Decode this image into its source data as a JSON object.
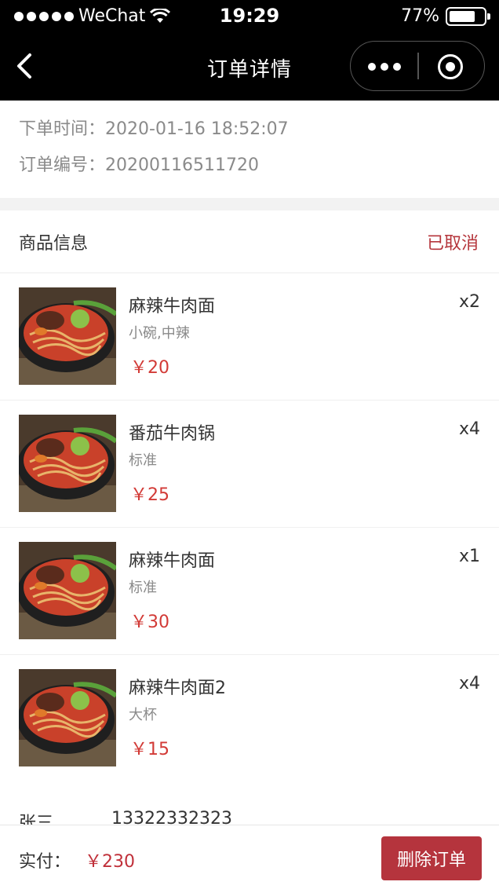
{
  "status_bar": {
    "carrier": "WeChat",
    "time": "19:29",
    "battery_percent": "77%",
    "battery_level": 0.77
  },
  "nav": {
    "title": "订单详情",
    "back_icon": "back-icon",
    "more_icon": "more-icon",
    "close_icon": "close-mini-program-icon"
  },
  "order": {
    "time_label": "下单时间：",
    "time_value": "2020-01-16 18:52:07",
    "number_label": "订单编号：",
    "number_value": "20200116511720"
  },
  "section": {
    "title": "商品信息",
    "status": "已取消"
  },
  "items": [
    {
      "name": "麻辣牛肉面",
      "spec": "小碗,中辣",
      "price": "￥20",
      "qty": "x2"
    },
    {
      "name": "番茄牛肉锅",
      "spec": "标准",
      "price": "￥25",
      "qty": "x4"
    },
    {
      "name": "麻辣牛肉面",
      "spec": "标准",
      "price": "￥30",
      "qty": "x1"
    },
    {
      "name": "麻辣牛肉面2",
      "spec": "大杯",
      "price": "￥15",
      "qty": "x4"
    }
  ],
  "contact": {
    "name": "张三",
    "phone": "13322332323"
  },
  "footer": {
    "paid_label": "实付：",
    "paid_amount": "￥230",
    "delete_label": "删除订单"
  },
  "colors": {
    "accent_red": "#b5343d",
    "price_red": "#d23a36",
    "status_red": "#b5363c"
  }
}
